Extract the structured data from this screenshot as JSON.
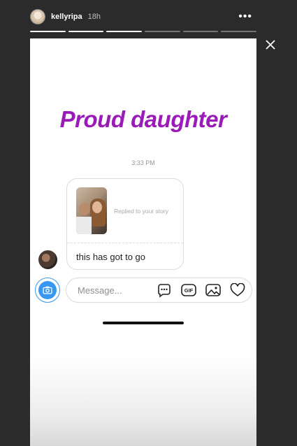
{
  "header": {
    "username": "kellyripa",
    "time_ago": "18h",
    "progress": [
      1,
      1,
      1,
      0,
      0,
      0
    ]
  },
  "story": {
    "sticker_text": "Proud daughter",
    "message_time": "3:33 PM",
    "reply_label": "Replied to your story",
    "message_text": "this has got to go"
  },
  "composer": {
    "placeholder": "Message...",
    "gif_label": "GIF"
  },
  "icons": {
    "more": "more-dots-icon",
    "close": "close-icon",
    "camera": "camera-icon",
    "sticker": "sticker-chat-icon",
    "gif": "gif-icon",
    "gallery": "gallery-icon",
    "heart": "heart-icon"
  },
  "colors": {
    "sticker_purple": "#9a1bb8",
    "accent_blue": "#3897f0",
    "background": "#2b2b2b"
  }
}
